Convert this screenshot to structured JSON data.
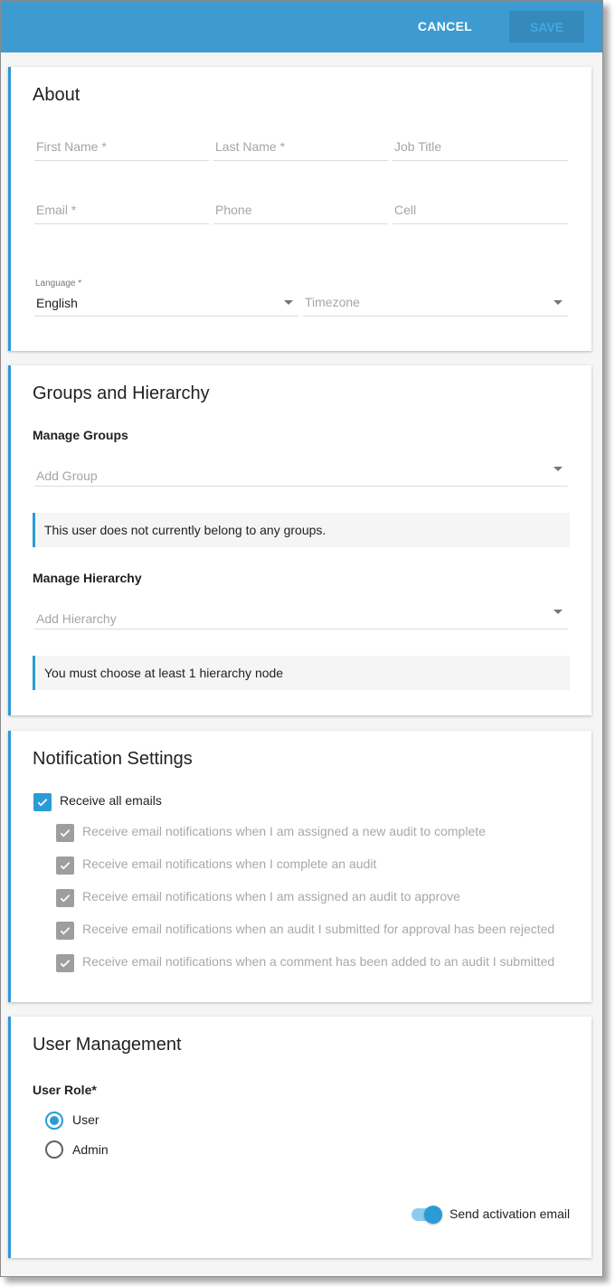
{
  "header": {
    "cancel_label": "CANCEL",
    "save_label": "SAVE",
    "accent_color": "#3d9bd1"
  },
  "about": {
    "title": "About",
    "fields": {
      "first_name": "First Name *",
      "last_name": "Last Name *",
      "job_title": "Job Title",
      "email": "Email *",
      "phone": "Phone",
      "cell": "Cell"
    },
    "language": {
      "label": "Language *",
      "value": "English"
    },
    "timezone": {
      "placeholder": "Timezone"
    }
  },
  "groups": {
    "title": "Groups and Hierarchy",
    "manage_groups_label": "Manage Groups",
    "add_group_placeholder": "Add Group",
    "groups_info": "This user does not currently belong to any groups.",
    "manage_hierarchy_label": "Manage Hierarchy",
    "add_hierarchy_placeholder": "Add Hierarchy",
    "hierarchy_info": "You must choose at least 1 hierarchy node"
  },
  "notifications": {
    "title": "Notification Settings",
    "receive_all": {
      "label": "Receive all emails",
      "checked": true
    },
    "options": [
      {
        "label": "Receive email notifications when I am assigned a new audit to complete",
        "checked": true
      },
      {
        "label": "Receive email notifications when I complete an audit",
        "checked": true
      },
      {
        "label": "Receive email notifications when I am assigned an audit to approve",
        "checked": true
      },
      {
        "label": "Receive email notifications when an audit I submitted for approval has been rejected",
        "checked": true
      },
      {
        "label": "Receive email notifications when a comment has been added to an audit I submitted",
        "checked": true
      }
    ]
  },
  "user_management": {
    "title": "User Management",
    "role_label": "User Role*",
    "roles": [
      {
        "label": "User",
        "selected": true
      },
      {
        "label": "Admin",
        "selected": false
      }
    ],
    "activation_toggle": {
      "label": "Send activation email",
      "on": true
    }
  }
}
